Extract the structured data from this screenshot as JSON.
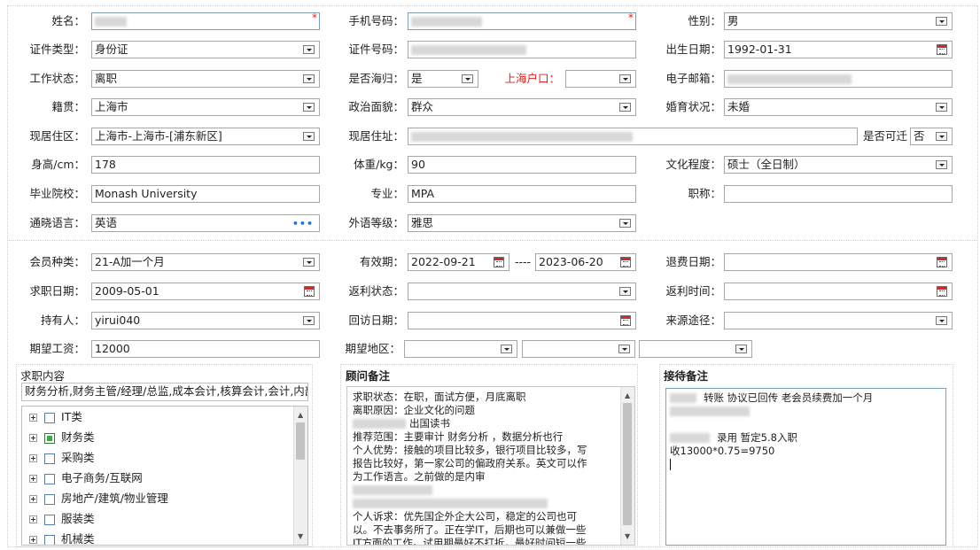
{
  "basic": {
    "name_label": "姓名：",
    "phone_label": "手机号码：",
    "gender_label": "性别：",
    "gender_value": "男",
    "idtype_label": "证件类型：",
    "idtype_value": "身份证",
    "idno_label": "证件号码：",
    "birth_label": "出生日期：",
    "birth_value": "1992-01-31",
    "workstatus_label": "工作状态：",
    "workstatus_value": "离职",
    "returnee_label": "是否海归：",
    "returnee_value": "是",
    "hukou_label": "上海户口：",
    "hukou_value": "",
    "email_label": "电子邮箱：",
    "origin_label": "籍贯：",
    "origin_value": "上海市",
    "political_label": "政治面貌：",
    "political_value": "群众",
    "marital_label": "婚育状况：",
    "marital_value": "未婚",
    "residence_label": "现居住区：",
    "residence_value": "上海市-上海市-[浦东新区]",
    "address_label": "现居住址：",
    "relocate_label": "是否可迁",
    "relocate_value": "否",
    "height_label": "身高/cm：",
    "height_value": "178",
    "weight_label": "体重/kg：",
    "weight_value": "90",
    "education_label": "文化程度：",
    "education_value": "硕士（全日制）",
    "school_label": "毕业院校：",
    "school_value": "Monash University",
    "major_label": "专业：",
    "major_value": "MPA",
    "title_label": "职称：",
    "title_value": "",
    "language_label": "通晓语言：",
    "language_value": "英语",
    "language_more": "•••",
    "langlevel_label": "外语等级：",
    "langlevel_value": "雅思"
  },
  "membership": {
    "type_label": "会员种类：",
    "type_value": "21-A加一个月",
    "valid_label": "有效期：",
    "valid_from": "2022-09-21",
    "valid_sep": "----",
    "valid_to": "2023-06-20",
    "refund_date_label": "退费日期：",
    "refund_date_value": "",
    "job_date_label": "求职日期：",
    "job_date_value": "2009-05-01",
    "rebate_status_label": "返利状态：",
    "rebate_time_label": "返利时间：",
    "holder_label": "持有人：",
    "holder_value": "yirui040",
    "visit_date_label": "回访日期：",
    "source_label": "来源途径：",
    "salary_label": "期望工资：",
    "salary_value": "12000",
    "region_label": "期望地区："
  },
  "job_content": {
    "title": "求职内容",
    "summary": "财务分析,财务主管/经理/总监,成本会计,核算会计,会计,内部审计",
    "items": [
      {
        "label": "IT类",
        "checked": false
      },
      {
        "label": "财务类",
        "checked": true
      },
      {
        "label": "采购类",
        "checked": false
      },
      {
        "label": "电子商务/互联网",
        "checked": false
      },
      {
        "label": "房地产/建筑/物业管理",
        "checked": false
      },
      {
        "label": "服装类",
        "checked": false
      },
      {
        "label": "机械类",
        "checked": false
      }
    ]
  },
  "consultant_notes": {
    "title": "顾问备注",
    "lines": [
      "求职状态：在职，面试方便，月底离职",
      "离职原因：企业文化的问题",
      "出国读书",
      "推荐范围：主要审计 财务分析 ，数据分析也行",
      "个人优势：接触的项目比较多，银行项目比较多，写",
      "报告比较好，第一家公司的偏政府关系。英文可以作",
      "为工作语言。之前做的是内审",
      "",
      "",
      "个人诉求：优先国企外企大公司，稳定的公司也可",
      "以。不去事务所了。正在学IT，后期也可以兼做一些",
      "IT方面的工作。试用期最好不打折，最好时间短一些"
    ]
  },
  "reception_notes": {
    "title": "接待备注",
    "lines": [
      "转账  协议已回传  老会员续费加一个月",
      "",
      "",
      "录用  暂定5.8入职",
      "收13000*0.75=9750"
    ]
  }
}
